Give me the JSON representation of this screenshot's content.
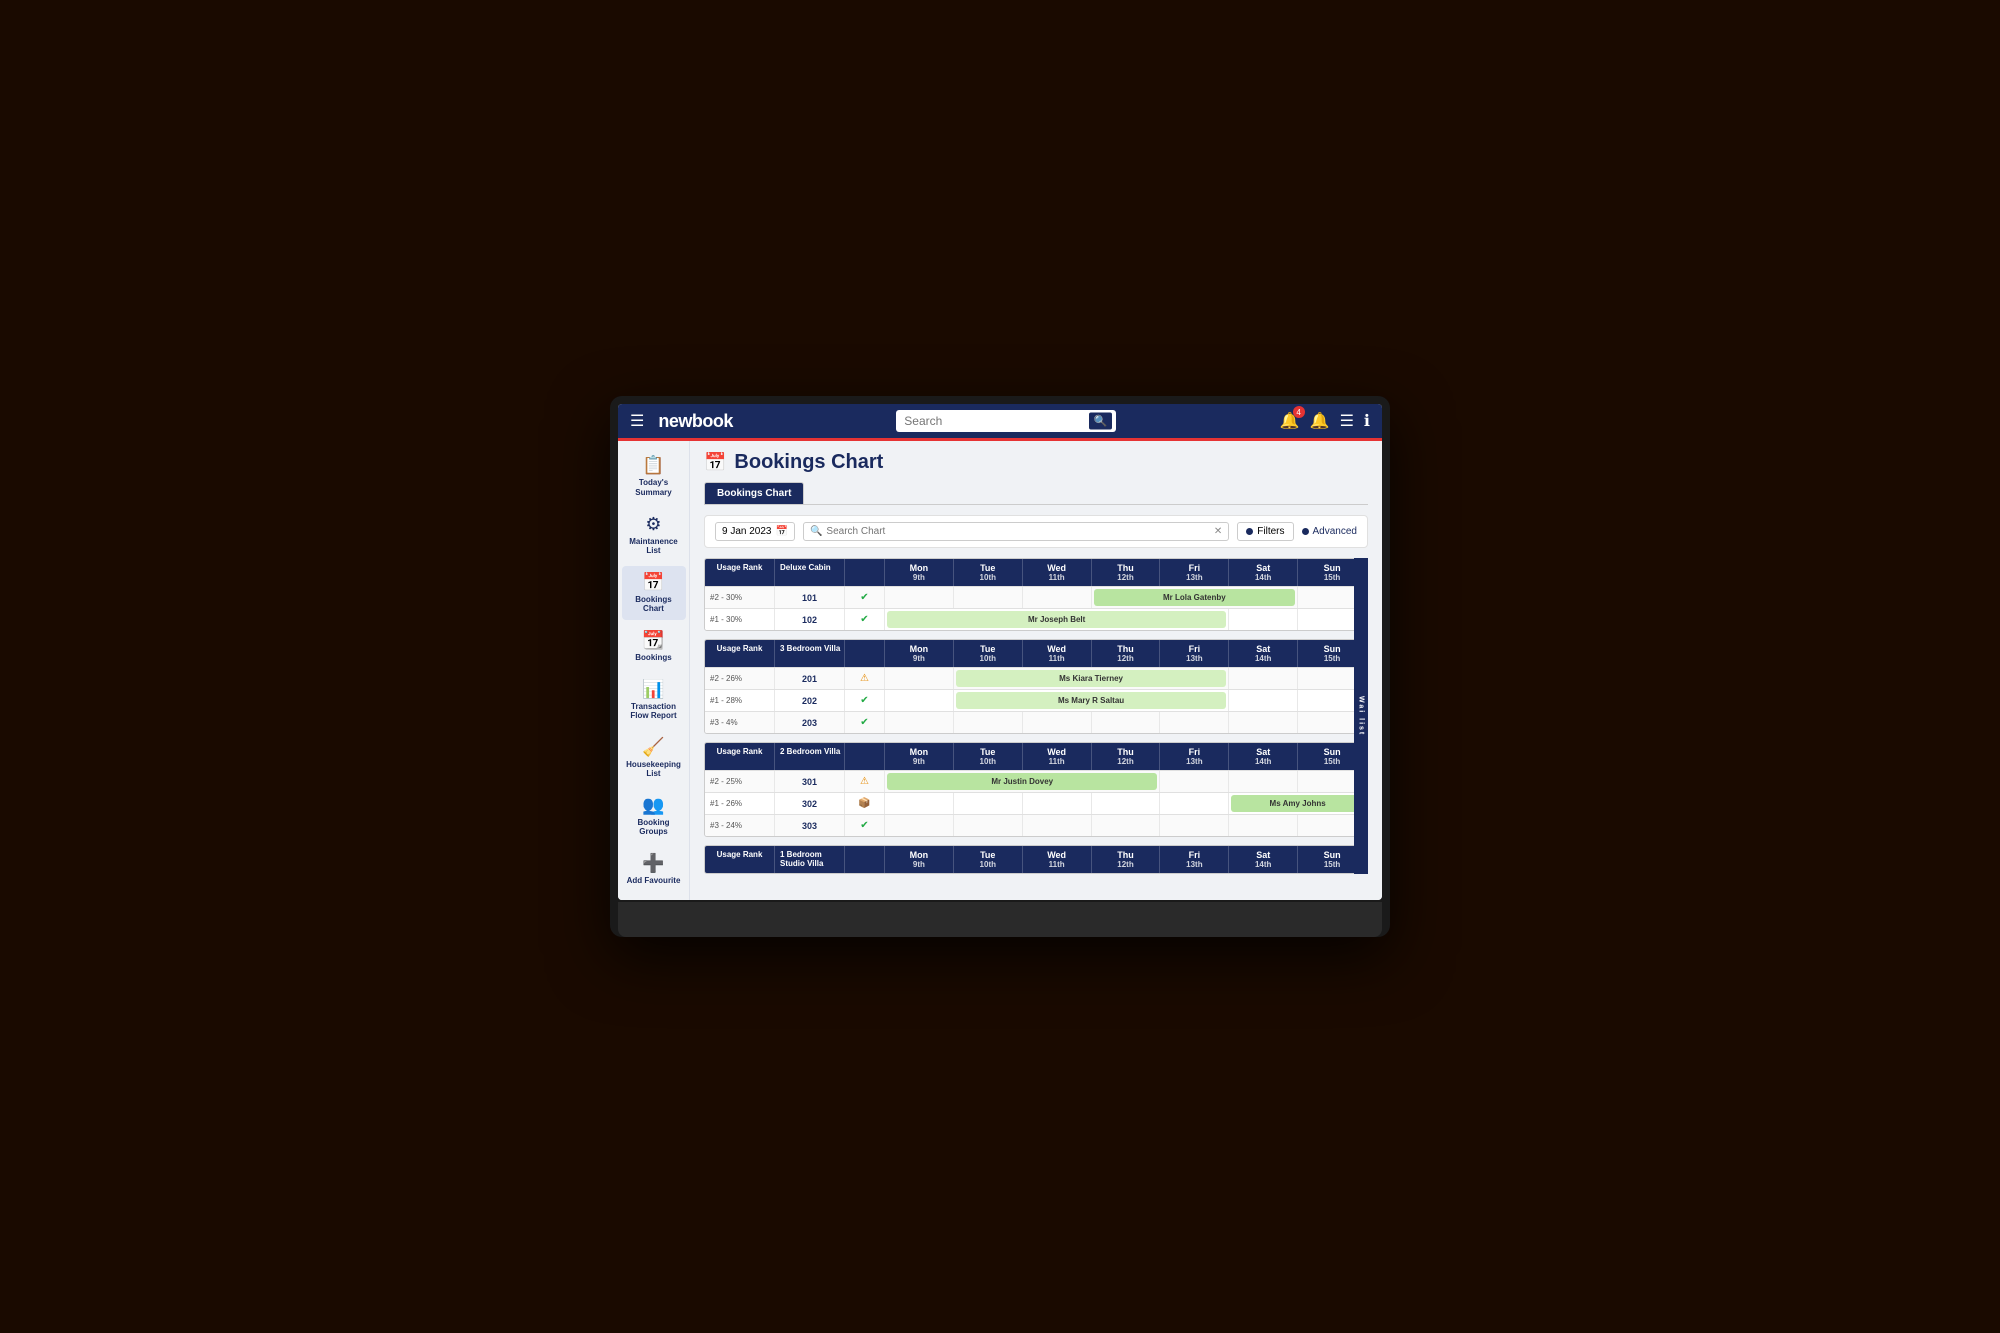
{
  "app": {
    "name": "newbook",
    "title": "Bookings Chart"
  },
  "nav": {
    "search_placeholder": "Search",
    "icons": [
      "🔔",
      "☰",
      "ℹ"
    ],
    "notification_count": "4"
  },
  "sidebar": {
    "items": [
      {
        "id": "todays-summary",
        "label": "Today's Summary",
        "icon": "📋"
      },
      {
        "id": "maintenance-list",
        "label": "Maintanence List",
        "icon": "⚙"
      },
      {
        "id": "bookings-chart",
        "label": "Bookings Chart",
        "icon": "📅",
        "active": true
      },
      {
        "id": "bookings",
        "label": "Bookings",
        "icon": "📆"
      },
      {
        "id": "transaction-flow",
        "label": "Transaction Flow Report",
        "icon": "📊"
      },
      {
        "id": "housekeeping",
        "label": "Housekeeping List",
        "icon": "🧹"
      },
      {
        "id": "booking-groups",
        "label": "Booking Groups",
        "icon": "👥"
      },
      {
        "id": "add-favourite",
        "label": "Add Favourite",
        "icon": "➕"
      }
    ]
  },
  "tabs": [
    {
      "id": "bookings-chart-tab",
      "label": "Bookings Chart"
    }
  ],
  "controls": {
    "date": "9 Jan 2023",
    "search_placeholder": "Search Chart",
    "filters_label": "Filters",
    "advanced_label": "Advanced"
  },
  "sections": [
    {
      "id": "deluxe-cabin",
      "category": "Deluxe Cabin",
      "days": [
        {
          "name": "Mon",
          "num": "9th"
        },
        {
          "name": "Tue",
          "num": "10th"
        },
        {
          "name": "Wed",
          "num": "11th"
        },
        {
          "name": "Thu",
          "num": "12th"
        },
        {
          "name": "Fri",
          "num": "13th"
        },
        {
          "name": "Sat",
          "num": "14th"
        },
        {
          "name": "Sun",
          "num": "15th"
        }
      ],
      "rows": [
        {
          "rank": "#2 - 30%",
          "room": "101",
          "status": "check",
          "bookings": [
            {
              "guest": "Mr Lola Gatenby",
              "start": 4,
              "span": 3,
              "color": "green"
            }
          ]
        },
        {
          "rank": "#1 - 30%",
          "room": "102",
          "status": "check",
          "bookings": [
            {
              "guest": "Mr Joseph Belt",
              "start": 1,
              "span": 5,
              "color": "light-green"
            }
          ]
        }
      ]
    },
    {
      "id": "three-bedroom-villa",
      "category": "3 Bedroom Villa",
      "days": [
        {
          "name": "Mon",
          "num": "9th"
        },
        {
          "name": "Tue",
          "num": "10th"
        },
        {
          "name": "Wed",
          "num": "11th"
        },
        {
          "name": "Thu",
          "num": "12th"
        },
        {
          "name": "Fri",
          "num": "13th"
        },
        {
          "name": "Sat",
          "num": "14th"
        },
        {
          "name": "Sun",
          "num": "15th"
        }
      ],
      "rows": [
        {
          "rank": "#2 - 26%",
          "room": "201",
          "status": "warning",
          "bookings": [
            {
              "guest": "Ms Kiara Tierney",
              "start": 2,
              "span": 4,
              "color": "light-green"
            }
          ]
        },
        {
          "rank": "#1 - 28%",
          "room": "202",
          "status": "check",
          "bookings": [
            {
              "guest": "Ms Mary R Saltau",
              "start": 2,
              "span": 4,
              "color": "light-green"
            }
          ]
        },
        {
          "rank": "#3 - 4%",
          "room": "203",
          "status": "check",
          "bookings": []
        }
      ]
    },
    {
      "id": "two-bedroom-villa",
      "category": "2 Bedroom Villa",
      "days": [
        {
          "name": "Mon",
          "num": "9th"
        },
        {
          "name": "Tue",
          "num": "10th"
        },
        {
          "name": "Wed",
          "num": "11th"
        },
        {
          "name": "Thu",
          "num": "12th"
        },
        {
          "name": "Fri",
          "num": "13th"
        },
        {
          "name": "Sat",
          "num": "14th"
        },
        {
          "name": "Sun",
          "num": "15th"
        }
      ],
      "rows": [
        {
          "rank": "#2 - 25%",
          "room": "301",
          "status": "warning",
          "bookings": [
            {
              "guest": "Mr Justin Dovey",
              "start": 0,
              "span": 4,
              "color": "green"
            }
          ]
        },
        {
          "rank": "#1 - 26%",
          "room": "302",
          "status": "box",
          "bookings": [
            {
              "guest": "Ms Amy Johns",
              "start": 5,
              "span": 2,
              "color": "green"
            }
          ]
        },
        {
          "rank": "#3 - 24%",
          "room": "303",
          "status": "check",
          "bookings": []
        }
      ]
    },
    {
      "id": "one-bedroom-studio",
      "category": "1 Bedroom Studio Villa",
      "days": [
        {
          "name": "Mon",
          "num": "9th"
        },
        {
          "name": "Tue",
          "num": "10th"
        },
        {
          "name": "Wed",
          "num": "11th"
        },
        {
          "name": "Thu",
          "num": "12th"
        },
        {
          "name": "Fri",
          "num": "13th"
        },
        {
          "name": "Sat",
          "num": "14th"
        },
        {
          "name": "Sun",
          "num": "15th"
        }
      ],
      "rows": []
    }
  ],
  "colors": {
    "nav_bg": "#1a2a5e",
    "accent_red": "#e63333",
    "booking_green": "#b8e4a0",
    "booking_light_green": "#d4f0c0"
  }
}
